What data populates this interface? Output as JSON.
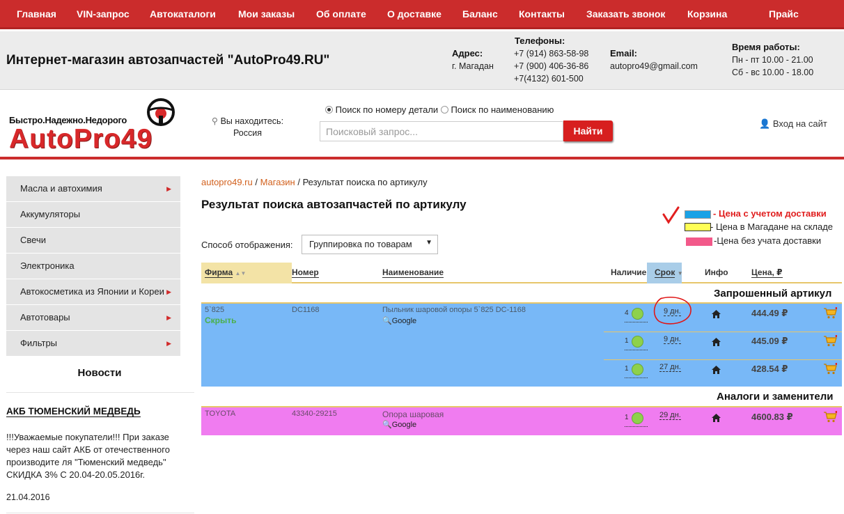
{
  "nav": [
    "Главная",
    "VIN-запрос",
    "Автокаталоги",
    "Мои заказы",
    "Об оплате",
    "О доставке",
    "Баланс",
    "Контакты",
    "Заказать звонок",
    "Корзина",
    "Прайс"
  ],
  "info": {
    "shop_name": "Интернет-магазин автозапчастей \"AutoPro49.RU\"",
    "address_label": "Адрес:",
    "address_value": "г. Магадан",
    "phones_label": "Телефоны:",
    "phones": [
      "+7 (914) 863-58-98",
      "+7 (900) 406-36-86",
      "+7(4132) 601-500"
    ],
    "email_label": "Email:",
    "email_value": "autopro49@gmail.com",
    "hours_label": "Время работы:",
    "hours": [
      "Пн - пт 10.00 - 21.00",
      "Сб - вс 10.00 - 18.00"
    ]
  },
  "header": {
    "slogan": "Быстро.Надежно.Недорого",
    "logo": "AutoPro49",
    "location_line1": "Вы находитесь:",
    "location_line2": "Россия",
    "radio_number": "Поиск по номеру детали",
    "radio_name": "Поиск по наименованию",
    "search_placeholder": "Поисковый запрос...",
    "search_button": "Найти",
    "login": "Вход на сайт"
  },
  "sidebar": {
    "items": [
      {
        "label": "Масла и автохимия",
        "arrow": true
      },
      {
        "label": "Аккумуляторы",
        "arrow": false
      },
      {
        "label": "Свечи",
        "arrow": false
      },
      {
        "label": "Электроника",
        "arrow": false
      },
      {
        "label": "Автокосметика из Японии и Кореи",
        "arrow": true
      },
      {
        "label": "Автотовары",
        "arrow": true
      },
      {
        "label": "Фильтры",
        "arrow": true
      }
    ],
    "news_heading": "Новости",
    "news_title": "АКБ ТЮМЕНСКИЙ МЕДВЕДЬ",
    "news_text": "!!!Уважаемые покупатели!!! При заказе через наш сайт АКБ от отечественного производите ля \"Тюменский медведь\" СКИДКА 3% С 20.04-20.05.2016г.",
    "news_date": "21.04.2016"
  },
  "main": {
    "breadcrumb": {
      "home": "autopro49.ru",
      "sep": " / ",
      "shop": "Магазин",
      "current": "Результат поиска по артикулу"
    },
    "title": "Результат поиска автозапчастей по артикулу",
    "display_label": "Способ отображения:",
    "display_value": "Группировка по товарам",
    "legend": [
      {
        "text": "- Цена с учетом доставки",
        "color": "#1aa2e6"
      },
      {
        "text": "- Цена в Магадане на складе",
        "color": "#ffff55"
      },
      {
        "text": "-Цена без учата доставки",
        "color": "#f2598a"
      }
    ],
    "columns": {
      "firm": "Фирма",
      "number": "Номер",
      "name": "Наименование",
      "avail": "Наличие",
      "term": "Срок",
      "info": "Инфо",
      "price": "Цена, ₽"
    },
    "requested_heading": "Запрошенный артикул",
    "analogs_heading": "Аналоги и заменители",
    "requested": {
      "firm": "5`825",
      "hide": "Скрыть",
      "number": "DC1168",
      "name": "Пыльник шаровой опоры 5`825 DC-1168",
      "google": "Google",
      "offers": [
        {
          "qty": "4",
          "term": "9 дн.",
          "price": "444.49 ₽"
        },
        {
          "qty": "1",
          "term": "9 дн.",
          "price": "445.09 ₽"
        },
        {
          "qty": "1",
          "term": "27 дн.",
          "price": "428.54 ₽"
        }
      ]
    },
    "analog": {
      "firm": "TOYOTA",
      "number": "43340-29215",
      "name": "Опора шаровая",
      "google": "Google",
      "offers": [
        {
          "qty": "1",
          "term": "29 дн.",
          "price": "4600.83 ₽"
        }
      ]
    }
  }
}
